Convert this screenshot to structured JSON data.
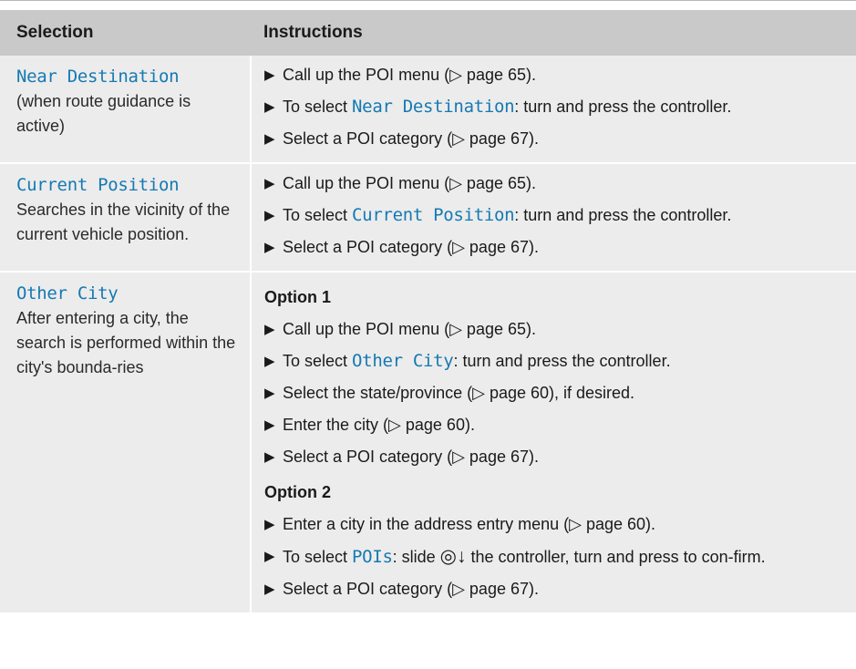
{
  "headers": {
    "selection": "Selection",
    "instructions": "Instructions"
  },
  "rows": [
    {
      "name": "Near Destination",
      "description": "(when route guidance is active)",
      "steps": [
        {
          "text": "Call up the POI menu (▷ page 65)."
        },
        {
          "prefix": "To select ",
          "highlight": "Near Destination",
          "suffix": ": turn and press the controller."
        },
        {
          "text": "Select a POI category (▷ page 67)."
        }
      ]
    },
    {
      "name": "Current Position",
      "description": "Searches in the vicinity of the current vehicle position.",
      "steps": [
        {
          "text": "Call up the POI menu (▷ page 65)."
        },
        {
          "prefix": "To select ",
          "highlight": "Current Position",
          "suffix": ": turn and press the controller."
        },
        {
          "text": "Select a POI category (▷ page 67)."
        }
      ]
    },
    {
      "name": "Other City",
      "description": "After entering a city, the search is performed within the city's bounda-ries",
      "options": [
        {
          "title": "Option 1",
          "steps": [
            {
              "text": "Call up the POI menu (▷ page 65)."
            },
            {
              "prefix": "To select ",
              "highlight": "Other City",
              "suffix": ": turn and press the controller."
            },
            {
              "text": "Select the state/province (▷ page 60), if desired."
            },
            {
              "text": "Enter the city (▷ page 60)."
            },
            {
              "text": "Select a POI category (▷ page 67)."
            }
          ]
        },
        {
          "title": "Option 2",
          "steps": [
            {
              "text": "Enter a city in the address entry menu (▷ page 60)."
            },
            {
              "prefix": "To select ",
              "highlight": "POIs",
              "middle": ": slide ",
              "icon": "◎↓",
              "suffix": " the controller, turn and press to con-firm."
            },
            {
              "text": "Select a POI category (▷ page 67)."
            }
          ]
        }
      ]
    }
  ],
  "bullet_glyph": "▶",
  "colors": {
    "header_bg": "#c9c9c9",
    "row_bg": "#ececec",
    "highlight": "#1579b3"
  }
}
